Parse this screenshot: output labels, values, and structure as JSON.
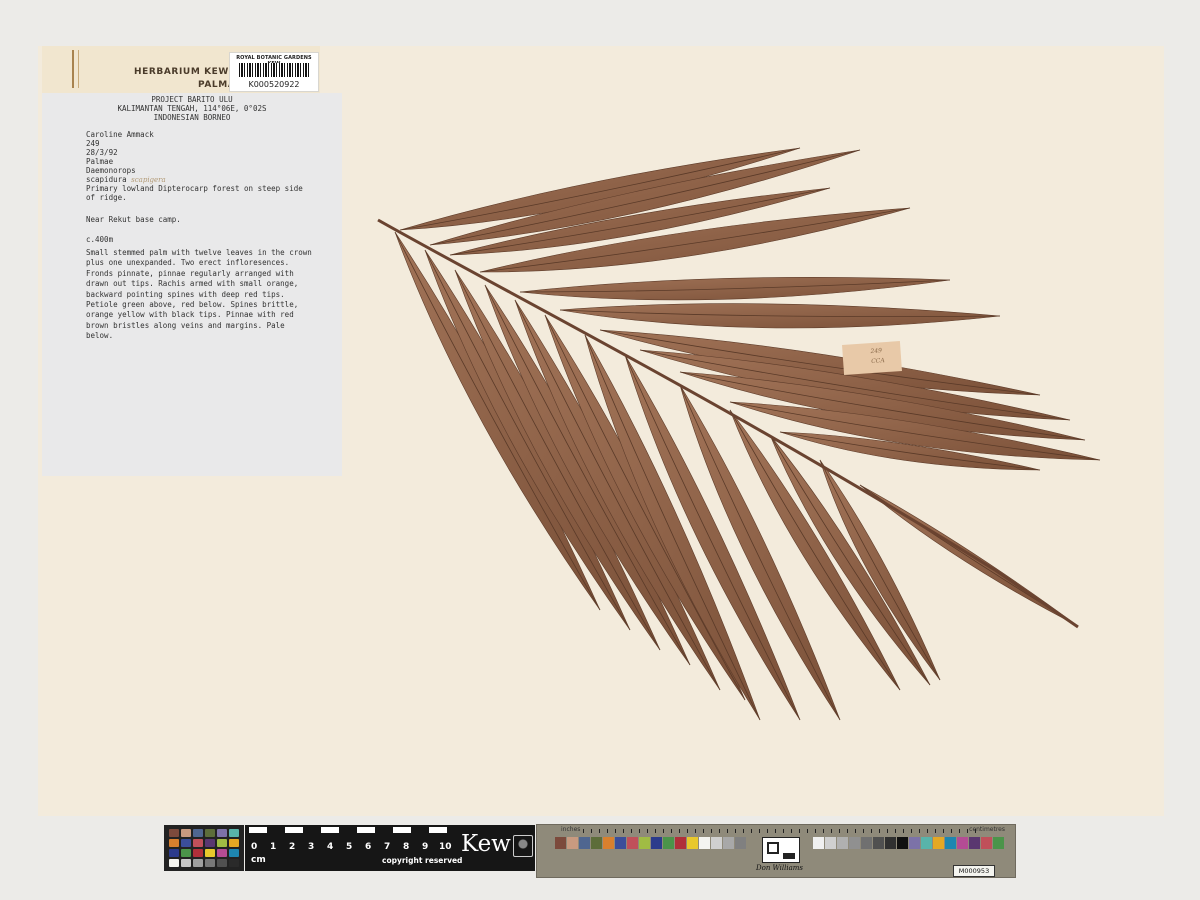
{
  "header_label": {
    "herbarium": "HERBARIUM KEWENSE",
    "family": "PALMAE"
  },
  "barcode_tag": {
    "header": "ROYAL BOTANIC GARDENS KEW",
    "number": "K000520922"
  },
  "label_card": {
    "project": "PROJECT BARITO ULU",
    "locality": "KALIMANTAN TENGAH, 114°06E, 0°02S",
    "region": "INDONESIAN BORNEO",
    "collector": "Caroline Ammack",
    "number": "249",
    "date": "28/3/92",
    "family": "Palmae",
    "genus": "Daemonorops",
    "species": "scapidura",
    "annotation": "scapigera",
    "habitat_1": "Primary lowland Dipterocarp forest on steep side",
    "habitat_2": "of ridge.",
    "location": "Near Rekut base camp.",
    "altitude": "c.400m",
    "description": "Small stemmed palm with twelve leaves in the crown plus one unexpanded. Two erect infloresences. Fronds pinnate, pinnae regularly arranged with drawn out tips. Rachis armed with small orange, backward pointing spines with deep red tips. Petiole green above, red below. Spines brittle, orange yellow with black tips. Pinnae with red brown bristles along veins and margins. Pale below."
  },
  "field_tag": {
    "line_1": "249",
    "line_2": "CCA"
  },
  "scale_bar": {
    "numbers": [
      "0",
      "1",
      "2",
      "3",
      "4",
      "5",
      "6",
      "7",
      "8",
      "9",
      "10"
    ],
    "unit": "cm",
    "copyright": "copyright reserved",
    "logo": "Kew"
  },
  "calibration_card": {
    "inches_label": "inches",
    "centimetres_label": "centimetres",
    "signature": "Don Williams",
    "card_id": "M000953"
  },
  "colors": {
    "sheet": "#f3ebdc",
    "frond": "#8c6044",
    "background": "#ecebe8"
  },
  "icons": [
    "crest-icon",
    "qr-icon"
  ]
}
